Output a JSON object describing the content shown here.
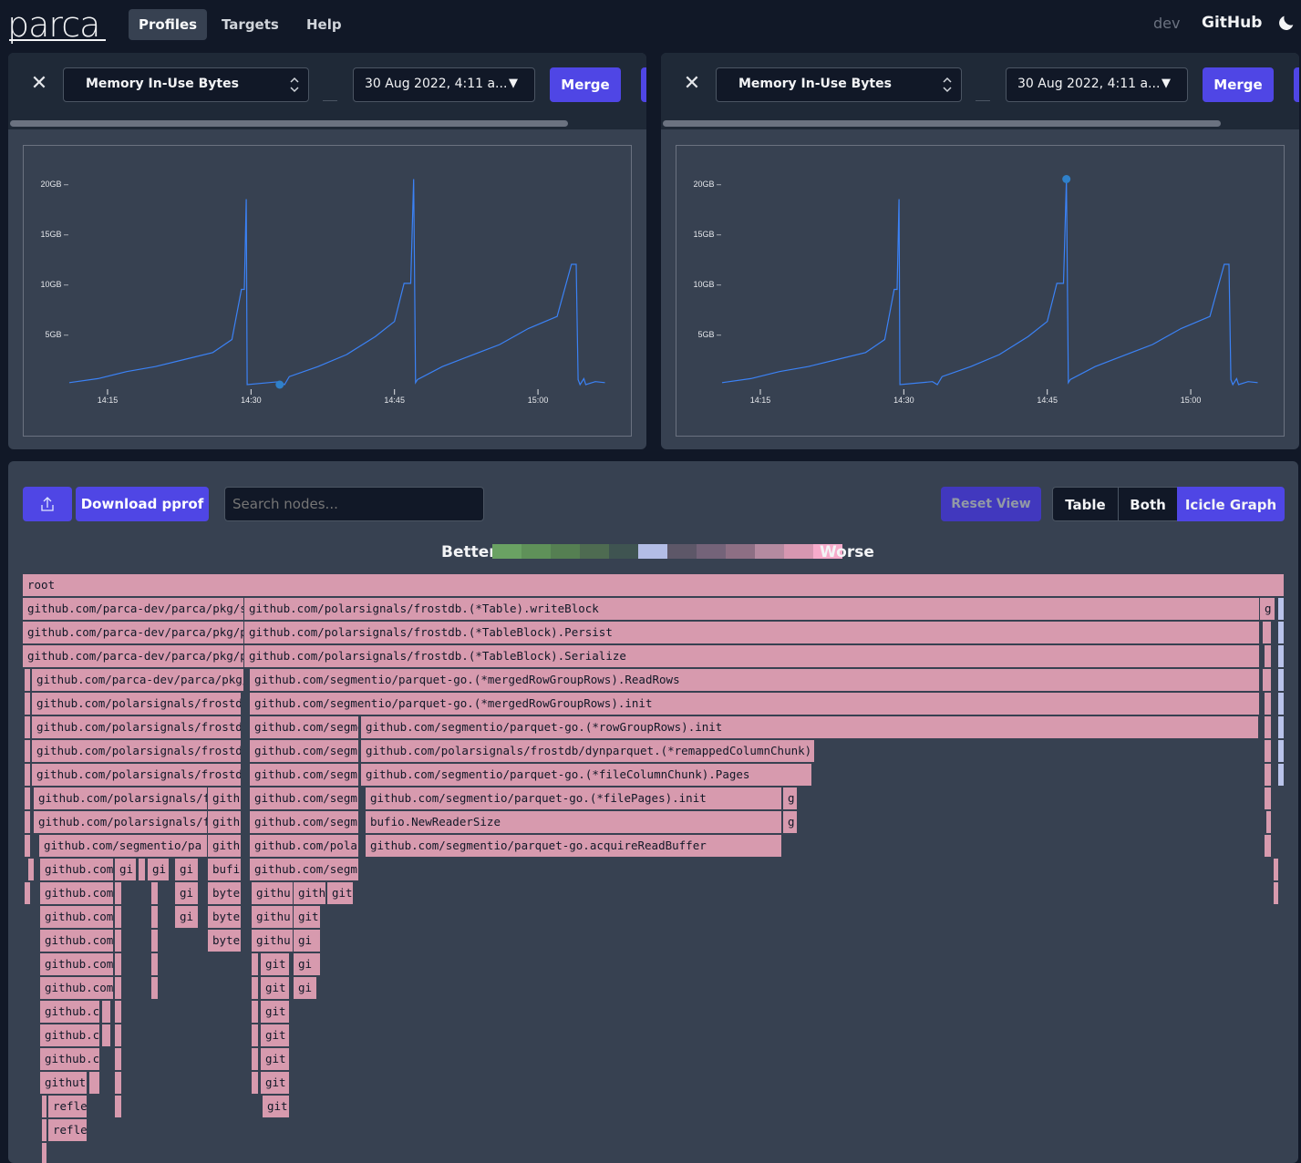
{
  "nav": {
    "logo": "parca",
    "links": [
      "Profiles",
      "Targets",
      "Help"
    ],
    "env": "dev",
    "github": "GitHub"
  },
  "panels": [
    {
      "profile_type": "Memory In-Use Bytes",
      "date": "30 Aug 2022, 4:11 a...",
      "merge_label": "Merge",
      "selected_point_index": 0
    },
    {
      "profile_type": "Memory In-Use Bytes",
      "date": "30 Aug 2022, 4:11 a...",
      "merge_label": "Merge",
      "selected_point_index": 1
    }
  ],
  "chart_data": [
    {
      "type": "line",
      "title": "",
      "xlabel": "",
      "ylabel": "",
      "x_ticks": [
        "14:15",
        "14:30",
        "14:45",
        "15:00"
      ],
      "y_ticks": [
        "5GB",
        "10GB",
        "15GB",
        "20GB"
      ],
      "ylim": [
        0,
        22
      ],
      "xlim": [
        "14:11",
        "15:08"
      ],
      "grid": false,
      "color": "#3b82f6",
      "x": [
        "14:11",
        "14:14",
        "14:17",
        "14:20",
        "14:23",
        "14:26",
        "14:28",
        "14:29",
        "14:29.3",
        "14:29.5",
        "14:29.6",
        "14:33",
        "14:33.5",
        "14:34",
        "14:37",
        "14:40",
        "14:43",
        "14:45",
        "14:46",
        "14:46.7",
        "14:47",
        "14:47.2",
        "14:47.4",
        "14:50",
        "14:53",
        "14:56",
        "14:59",
        "15:02",
        "15:03.5",
        "15:04",
        "15:04.2",
        "15:04.4",
        "15:04.8",
        "15:05",
        "15:06",
        "15:07"
      ],
      "values": [
        0.2,
        0.6,
        1.3,
        1.8,
        2.5,
        3.2,
        4.5,
        9.5,
        9.5,
        18.5,
        0.0,
        0.3,
        0.0,
        0.8,
        1.8,
        3.0,
        4.8,
        6.3,
        10.1,
        10.1,
        20.5,
        0.2,
        0.5,
        1.8,
        2.9,
        4.0,
        5.6,
        6.8,
        12.0,
        12.0,
        0.5,
        0.0,
        0.6,
        0.0,
        0.3,
        0.2
      ],
      "markers": [
        {
          "x": "14:33",
          "y": 0.0
        }
      ]
    },
    {
      "type": "line",
      "title": "",
      "xlabel": "",
      "ylabel": "",
      "x_ticks": [
        "14:15",
        "14:30",
        "14:45",
        "15:00"
      ],
      "y_ticks": [
        "5GB",
        "10GB",
        "15GB",
        "20GB"
      ],
      "ylim": [
        0,
        22
      ],
      "xlim": [
        "14:11",
        "15:08"
      ],
      "grid": false,
      "color": "#3b82f6",
      "x": [
        "14:11",
        "14:14",
        "14:17",
        "14:20",
        "14:23",
        "14:26",
        "14:28",
        "14:29",
        "14:29.3",
        "14:29.5",
        "14:29.6",
        "14:33",
        "14:33.5",
        "14:34",
        "14:37",
        "14:40",
        "14:43",
        "14:45",
        "14:46",
        "14:46.7",
        "14:47",
        "14:47.2",
        "14:47.4",
        "14:50",
        "14:53",
        "14:56",
        "14:59",
        "15:02",
        "15:03.5",
        "15:04",
        "15:04.2",
        "15:04.4",
        "15:04.8",
        "15:05",
        "15:06",
        "15:07"
      ],
      "values": [
        0.2,
        0.6,
        1.3,
        1.8,
        2.5,
        3.2,
        4.5,
        9.5,
        9.5,
        18.5,
        0.0,
        0.3,
        0.0,
        0.8,
        1.8,
        3.0,
        4.8,
        6.3,
        10.1,
        10.1,
        20.5,
        0.2,
        0.5,
        1.8,
        2.9,
        4.0,
        5.6,
        6.8,
        12.0,
        12.0,
        0.5,
        0.0,
        0.6,
        0.0,
        0.3,
        0.2
      ],
      "markers": [
        {
          "x": "14:47",
          "y": 20.5
        }
      ]
    }
  ],
  "toolbar": {
    "download_label": "Download pprof",
    "search_placeholder": "Search nodes...",
    "reset_label": "Reset View",
    "views": [
      "Table",
      "Both",
      "Icicle Graph"
    ],
    "active_view": "Icicle Graph"
  },
  "legend": {
    "better": "Better",
    "worse": "Worse",
    "colors": [
      "#6aa263",
      "#5f9159",
      "#557f52",
      "#4e6b51",
      "#3f5451",
      "#b3bde6",
      "#5d5768",
      "#746379",
      "#8d6f84",
      "#b48aa0",
      "#d697b1",
      "#f7abcb"
    ]
  },
  "flame_colors": {
    "main": "#d79aae",
    "blue": "#b9c3ea"
  },
  "flame": [
    {
      "label": "root"
    },
    {
      "label": "github.com/parca-dev/parca/pkg/scrape"
    },
    {
      "label": "github.com/polarsignals/frostdb.(*Table).writeBlock"
    },
    {
      "label": "g"
    },
    {
      "label": "github.com/parca-dev/parca/pkg/profilestore"
    },
    {
      "label": "github.com/polarsignals/frostdb.(*TableBlock).Persist"
    },
    {
      "label": "github.com/parca-dev/parca/pkg/parcacol"
    },
    {
      "label": "github.com/polarsignals/frostdb.(*TableBlock).Serialize"
    },
    {
      "label": "github.com/parca-dev/parca/pkg/"
    },
    {
      "label": "github.com/segmentio/parquet-go.(*mergedRowGroupRows).ReadRows"
    },
    {
      "label": "github.com/polarsignals/frostdb"
    },
    {
      "label": "github.com/segmentio/parquet-go.(*mergedRowGroupRows).init"
    },
    {
      "label": "github.com/polarsignals/frostdb"
    },
    {
      "label": "github.com/segmentio"
    },
    {
      "label": "github.com/segmentio/parquet-go.(*rowGroupRows).init"
    },
    {
      "label": "github.com/polarsignals/frostdb"
    },
    {
      "label": "github.com/segm"
    },
    {
      "label": "github.com/polarsignals/frostdb/dynparquet.(*remappedColumnChunk).Pages"
    },
    {
      "label": "github.com/polarsignals/frostdb"
    },
    {
      "label": "github.com/segm"
    },
    {
      "label": "github.com/segmentio/parquet-go.(*fileColumnChunk).Pages"
    },
    {
      "label": "github.com/polarsignals/f"
    },
    {
      "label": "gith"
    },
    {
      "label": "github.com/segm"
    },
    {
      "label": "github.com/segmentio/parquet-go.(*filePages).init"
    },
    {
      "label": "g"
    },
    {
      "label": "github.com/polarsignals/f"
    },
    {
      "label": "gith"
    },
    {
      "label": "github.com/segm"
    },
    {
      "label": "bufio.NewReaderSize"
    },
    {
      "label": "g"
    },
    {
      "label": "github.com/segmentio/pa"
    },
    {
      "label": "gith"
    },
    {
      "label": "github.com/pola"
    },
    {
      "label": "github.com/segmentio/parquet-go.acquireReadBuffer"
    },
    {
      "label": "github.com"
    },
    {
      "label": "gi"
    },
    {
      "label": "gi"
    },
    {
      "label": "gi"
    },
    {
      "label": "bufi"
    },
    {
      "label": "github.com/segm"
    },
    {
      "label": "github.com"
    },
    {
      "label": "gi"
    },
    {
      "label": "byte"
    },
    {
      "label": "githu"
    },
    {
      "label": "gith"
    },
    {
      "label": "git"
    },
    {
      "label": "github.com"
    },
    {
      "label": "gi"
    },
    {
      "label": "byte"
    },
    {
      "label": "githu"
    },
    {
      "label": "git"
    },
    {
      "label": "github.com"
    },
    {
      "label": "byte"
    },
    {
      "label": "githu"
    },
    {
      "label": "gi"
    },
    {
      "label": "github.com"
    },
    {
      "label": "git"
    },
    {
      "label": "gi"
    },
    {
      "label": "github.com"
    },
    {
      "label": "git"
    },
    {
      "label": "gi"
    },
    {
      "label": "github.c"
    },
    {
      "label": "git"
    },
    {
      "label": "github.c"
    },
    {
      "label": "git"
    },
    {
      "label": "github.c"
    },
    {
      "label": "git"
    },
    {
      "label": "githut"
    },
    {
      "label": "git"
    },
    {
      "label": "refle"
    },
    {
      "label": "git"
    },
    {
      "label": "refle"
    }
  ]
}
